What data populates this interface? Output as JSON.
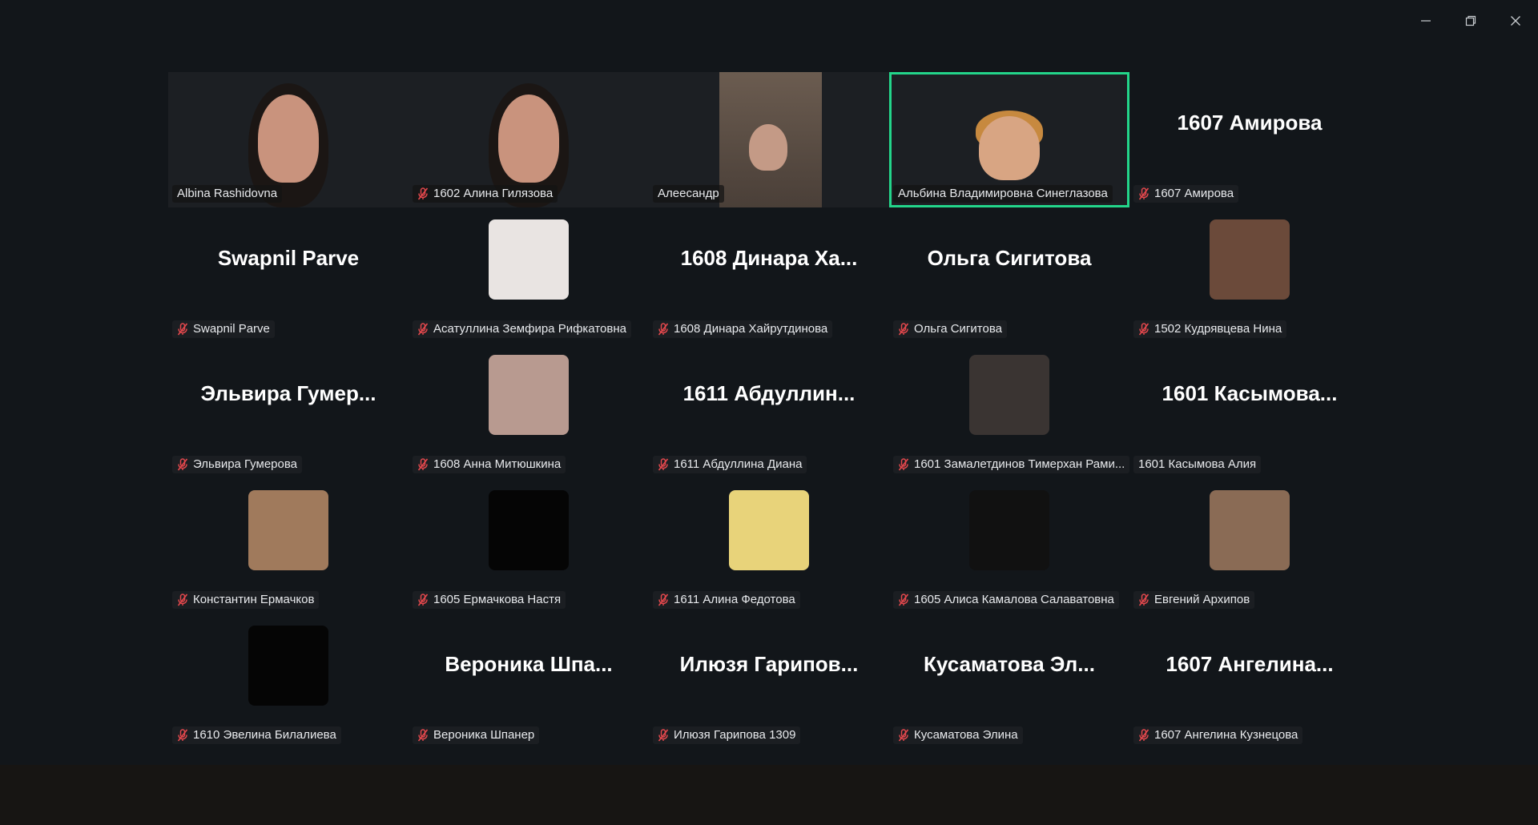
{
  "window_controls": {
    "minimize_icon": "minimize-icon",
    "restore_icon": "restore-icon",
    "close_icon": "close-icon"
  },
  "colors": {
    "active_speaker_border": "#23d58a",
    "muted_mic": "#e5484d",
    "background": "#12161a"
  },
  "tiles": [
    {
      "label": "Albina Rashidovna",
      "muted": false,
      "kind": "video",
      "bg": "v1"
    },
    {
      "label": "1602 Алина Гилязова",
      "muted": true,
      "kind": "video",
      "bg": "v2"
    },
    {
      "label": "Алеесандр",
      "muted": false,
      "kind": "video",
      "bg": "v3"
    },
    {
      "label": "Альбина Владимировна Синеглазова",
      "muted": false,
      "kind": "video",
      "bg": "v4",
      "active": true
    },
    {
      "label": "1607 Амирова",
      "muted": true,
      "kind": "name",
      "display": "1607 Амирова"
    },
    {
      "label": "Swapnil Parve",
      "muted": true,
      "kind": "name",
      "display": "Swapnil Parve"
    },
    {
      "label": "Асатуллина Земфира Рифкатовна",
      "muted": true,
      "kind": "avatar",
      "avatar_color": "#e9e4e2"
    },
    {
      "label": "1608 Динара Хайрутдинова",
      "muted": true,
      "kind": "name",
      "display": "1608 Динара Ха..."
    },
    {
      "label": "Ольга Сигитова",
      "muted": true,
      "kind": "name",
      "display": "Ольга Сигитова"
    },
    {
      "label": "1502 Кудрявцева Нина",
      "muted": true,
      "kind": "avatar",
      "avatar_color": "#6b4a3a"
    },
    {
      "label": "Эльвира Гумерова",
      "muted": true,
      "kind": "name",
      "display": "Эльвира Гумер..."
    },
    {
      "label": "1608 Анна Митюшкина",
      "muted": true,
      "kind": "avatar",
      "avatar_color": "#b89a90"
    },
    {
      "label": "1611 Абдуллина Диана",
      "muted": true,
      "kind": "name",
      "display": "1611 Абдуллин..."
    },
    {
      "label": "1601 Замалетдинов Тимерхан Рами...",
      "muted": true,
      "kind": "avatar",
      "avatar_color": "#3a3432"
    },
    {
      "label": "1601 Касымова Алия",
      "muted": false,
      "kind": "name",
      "display": "1601 Касымова..."
    },
    {
      "label": "Константин Ермачков",
      "muted": true,
      "kind": "avatar",
      "avatar_color": "#a07a5c"
    },
    {
      "label": "1605 Ермачкова Настя",
      "muted": true,
      "kind": "avatar",
      "avatar_color": "#050505"
    },
    {
      "label": "1611 Алина Федотова",
      "muted": true,
      "kind": "avatar",
      "avatar_color": "#e8d37a"
    },
    {
      "label": "1605 Алиса Камалова Салаватовна",
      "muted": true,
      "kind": "avatar",
      "avatar_color": "#111111"
    },
    {
      "label": "Евгений Архипов",
      "muted": true,
      "kind": "avatar",
      "avatar_color": "#8a6b55"
    },
    {
      "label": "1610 Эвелина Билалиева",
      "muted": true,
      "kind": "avatar",
      "avatar_color": "#050505"
    },
    {
      "label": "Вероника Шпанер",
      "muted": true,
      "kind": "name",
      "display": "Вероника Шпа..."
    },
    {
      "label": "Илюзя Гарипова 1309",
      "muted": true,
      "kind": "name",
      "display": "Илюзя Гарипов..."
    },
    {
      "label": "Кусаматова Элина",
      "muted": true,
      "kind": "name",
      "display": "Кусаматова Эл..."
    },
    {
      "label": "1607 Ангелина Кузнецова",
      "muted": true,
      "kind": "name",
      "display": "1607 Ангелина..."
    }
  ]
}
